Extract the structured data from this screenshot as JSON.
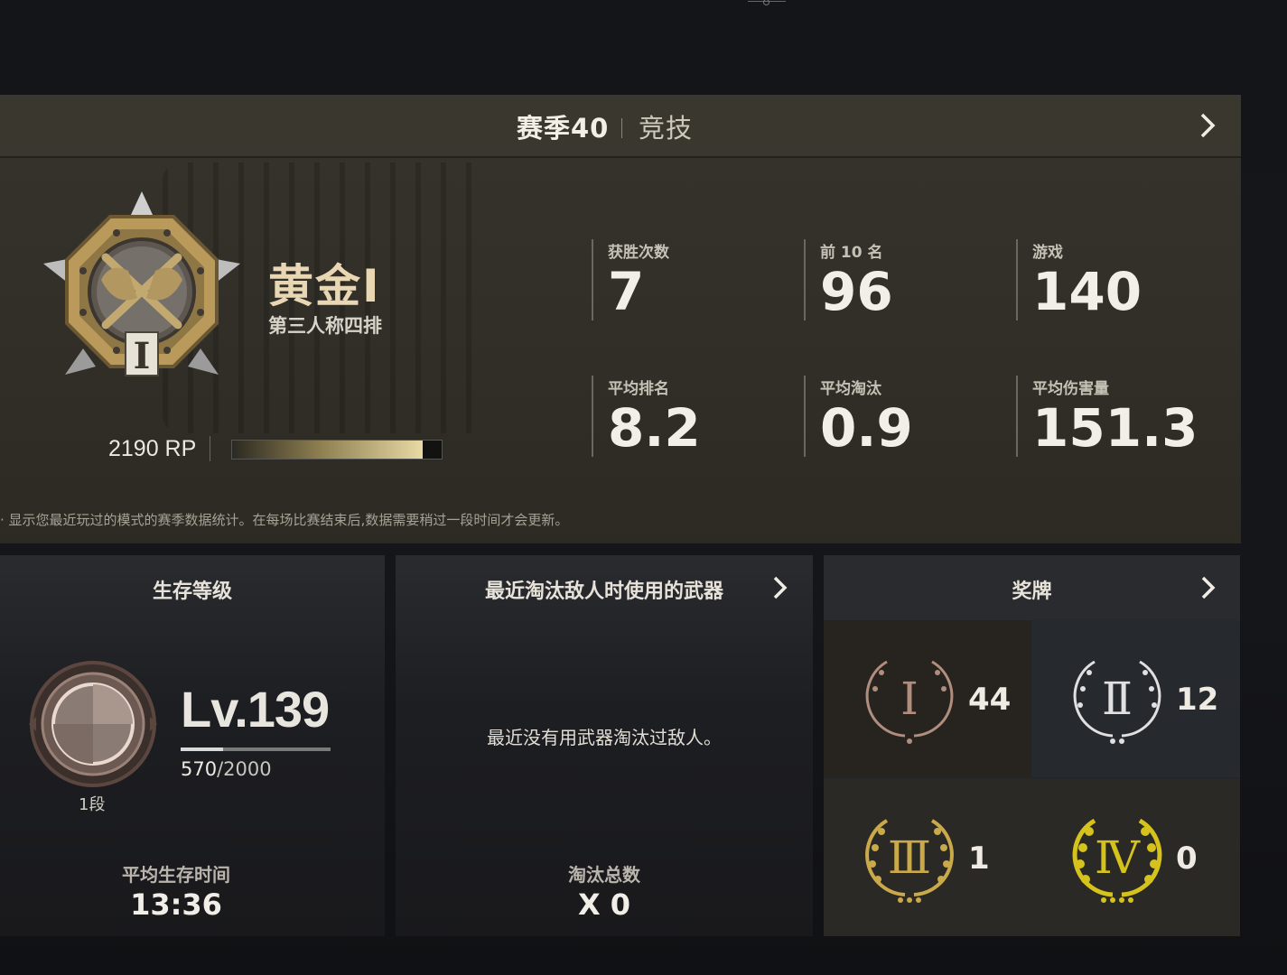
{
  "season": {
    "title": "赛季40",
    "mode": "竞技"
  },
  "rank": {
    "tier_name": "黄金I",
    "queue_mode": "第三人称四排",
    "badge_numeral": "I",
    "rp_text": "2190 RP",
    "rp_progress_fraction": 0.91
  },
  "stats": [
    {
      "label": "获胜次数",
      "value": "7"
    },
    {
      "label": "前 10 名",
      "value": "96"
    },
    {
      "label": "游戏",
      "value": "140"
    },
    {
      "label": "平均排名",
      "value": "8.2"
    },
    {
      "label": "平均淘汰",
      "value": "0.9"
    },
    {
      "label": "平均伤害量",
      "value": "151.3"
    }
  ],
  "footnote": "显示您最近玩过的模式的赛季数据统计。在每场比赛结束后,数据需要稍过一段时间才会更新。",
  "survival": {
    "title": "生存等级",
    "level": "Lv.139",
    "xp_current": "570",
    "xp_total": "/2000",
    "xp_fraction": 0.285,
    "dan": "1段",
    "avg_time_label": "平均生存时间",
    "avg_time_value": "13:36"
  },
  "weapons": {
    "title": "最近淘汰敌人时使用的武器",
    "empty_text": "最近没有用武器淘汰过敌人。",
    "elim_label": "淘汰总数",
    "elim_value": "X 0"
  },
  "medals": {
    "title": "奖牌",
    "items": [
      {
        "tier": "Ⅰ",
        "count": "44",
        "color": "#b08e7e"
      },
      {
        "tier": "Ⅱ",
        "count": "12",
        "color": "#d9d9d9"
      },
      {
        "tier": "Ⅲ",
        "count": "1",
        "color": "#c9a94a"
      },
      {
        "tier": "Ⅳ",
        "count": "0",
        "color": "#d6c21c"
      }
    ]
  },
  "colors": {
    "gold_text": "#e9d7b3",
    "season_panel": "#36332c",
    "dark_panel": "#1d1e22"
  }
}
